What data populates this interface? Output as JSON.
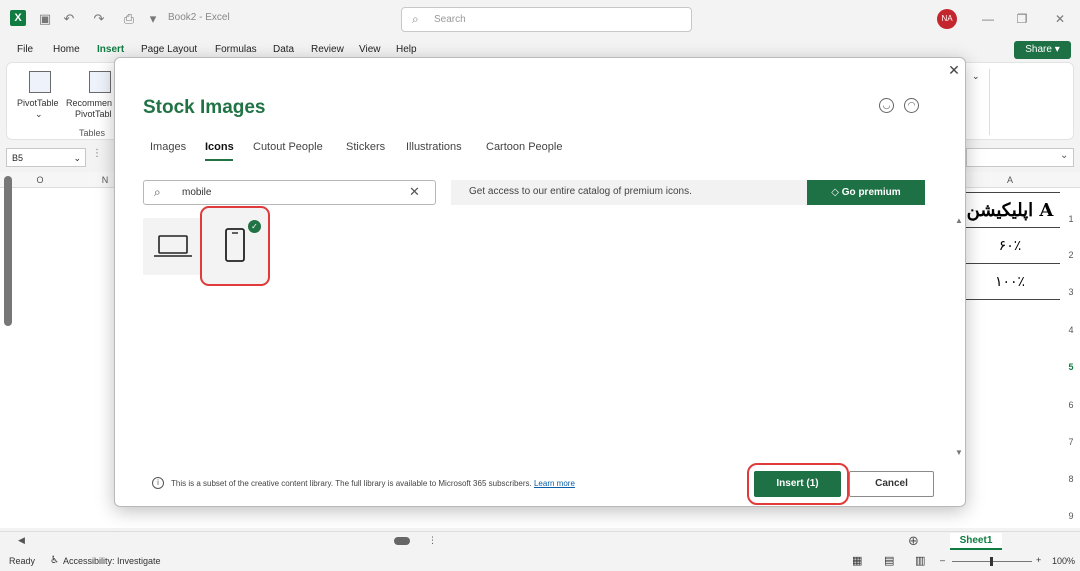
{
  "titlebar": {
    "doc_title": "Book2  -  Excel",
    "search_placeholder": "Search",
    "avatar_initials": "NA"
  },
  "menu": {
    "items": [
      "File",
      "Home",
      "Insert",
      "Page Layout",
      "Formulas",
      "Data",
      "Review",
      "View",
      "Help"
    ],
    "active": "Insert",
    "share_label": "Share"
  },
  "ribbon": {
    "pivot_label": "PivotTable",
    "recommended_label_1": "Recommen",
    "recommended_label_2": "PivotTabl",
    "group_label": "Tables"
  },
  "formula_bar": {
    "name_box": "B5"
  },
  "grid": {
    "column_headers": [
      "O",
      "N",
      "A"
    ],
    "row_numbers": [
      "1",
      "2",
      "3",
      "4",
      "5",
      "6",
      "7",
      "8",
      "9"
    ],
    "cells": {
      "a1": "اپلیکیشن A",
      "a2": "۶۰٪",
      "a3": "۱۰۰٪"
    }
  },
  "sheet": {
    "tab": "Sheet1"
  },
  "status": {
    "ready": "Ready",
    "accessibility": "Accessibility: Investigate",
    "zoom": "100%"
  },
  "dialog": {
    "title": "Stock Images",
    "tabs": [
      "Images",
      "Icons",
      "Cutout People",
      "Stickers",
      "Illustrations",
      "Cartoon People"
    ],
    "active_tab": "Icons",
    "search_value": "mobile",
    "premium_text": "Get access to our entire catalog of premium icons.",
    "premium_button": "Go premium",
    "results": [
      {
        "icon": "laptop-icon",
        "selected": false
      },
      {
        "icon": "mobile-phone-icon",
        "selected": true
      }
    ],
    "info_text": "This is a subset of the creative content library. The full library is available to Microsoft 365 subscribers.",
    "learn_more": "Learn more",
    "insert_button": "Insert (1)",
    "cancel_button": "Cancel"
  },
  "colors": {
    "accent": "#217346",
    "highlight_ring": "#e03a3a"
  }
}
